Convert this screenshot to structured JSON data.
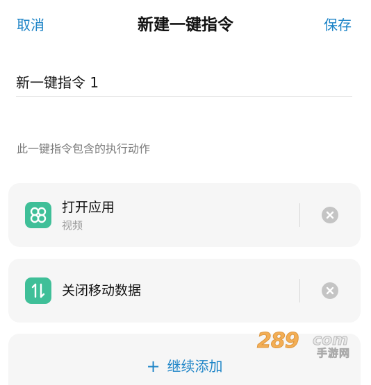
{
  "header": {
    "cancel_label": "取消",
    "title": "新建一键指令",
    "save_label": "保存"
  },
  "name_field": {
    "value": "新一键指令 1"
  },
  "section_label": "此一键指令包含的执行动作",
  "actions": [
    {
      "icon": "app-grid-icon",
      "title": "打开应用",
      "subtitle": "视频"
    },
    {
      "icon": "mobile-data-arrows-icon",
      "title": "关闭移动数据",
      "subtitle": ""
    }
  ],
  "add_more_label": "继续添加",
  "watermark": {
    "number": "289",
    "domain": "com",
    "text": "手游网"
  },
  "colors": {
    "accent": "#1d84c7",
    "icon_bg": "#3fbf98",
    "card_bg": "#f6f6f6",
    "remove_bg": "#c4c4c4"
  }
}
